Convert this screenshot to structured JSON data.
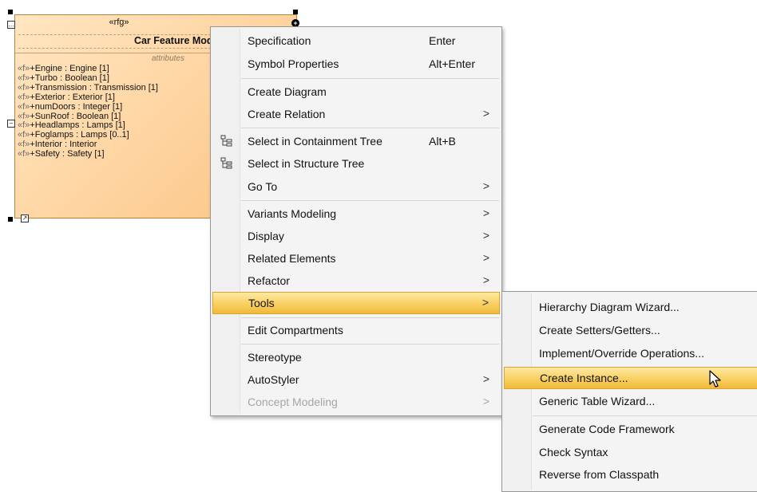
{
  "class_symbol": {
    "stereotype": "«rfg»",
    "name": "Car Feature Model",
    "compartment_title": "attributes",
    "attributes": [
      {
        "stereo": "«f»",
        "text": "+Engine : Engine [1]"
      },
      {
        "stereo": "«f»",
        "text": "+Turbo : Boolean [1]"
      },
      {
        "stereo": "«f»",
        "text": "+Transmission : Transmission [1]"
      },
      {
        "stereo": "«f»",
        "text": "+Exterior : Exterior [1]"
      },
      {
        "stereo": "«f»",
        "text": "+numDoors : Integer [1]"
      },
      {
        "stereo": "«f»",
        "text": "+SunRoof : Boolean [1]"
      },
      {
        "stereo": "«f»",
        "text": "+Headlamps : Lamps [1]"
      },
      {
        "stereo": "«f»",
        "text": "+Foglamps : Lamps [0..1]"
      },
      {
        "stereo": "«f»",
        "text": "+Interior : Interior"
      },
      {
        "stereo": "«f»",
        "text": "+Safety : Safety [1]"
      }
    ]
  },
  "context_menu": {
    "items": [
      {
        "label": "Specification",
        "shortcut": "Enter"
      },
      {
        "label": "Symbol Properties",
        "shortcut": "Alt+Enter"
      },
      {
        "label": "Create Diagram"
      },
      {
        "label": "Create Relation",
        "arrow": ">"
      },
      {
        "label": "Select in Containment Tree",
        "shortcut": "Alt+B",
        "icon": "containment-tree-icon"
      },
      {
        "label": "Select in Structure Tree",
        "icon": "structure-tree-icon"
      },
      {
        "label": "Go To",
        "arrow": ">"
      },
      {
        "label": "Variants Modeling",
        "arrow": ">"
      },
      {
        "label": "Display",
        "arrow": ">"
      },
      {
        "label": "Related Elements",
        "arrow": ">"
      },
      {
        "label": "Refactor",
        "arrow": ">"
      },
      {
        "label": "Tools",
        "arrow": ">",
        "highlighted": true
      },
      {
        "label": "Edit Compartments"
      },
      {
        "label": "Stereotype"
      },
      {
        "label": "AutoStyler",
        "arrow": ">"
      },
      {
        "label": "Concept Modeling",
        "arrow": ">",
        "disabled": true
      }
    ]
  },
  "tools_submenu": {
    "items": [
      {
        "label": "Hierarchy Diagram Wizard..."
      },
      {
        "label": "Create Setters/Getters..."
      },
      {
        "label": "Implement/Override Operations..."
      },
      {
        "label": "Create Instance...",
        "highlighted": true
      },
      {
        "label": "Generic Table Wizard..."
      },
      {
        "label": "Generate Code Framework"
      },
      {
        "label": "Check Syntax"
      },
      {
        "label": "Reverse from Classpath"
      }
    ]
  },
  "colors": {
    "menu_highlight": "#f8d062",
    "class_fill": "#ffd7a6"
  }
}
